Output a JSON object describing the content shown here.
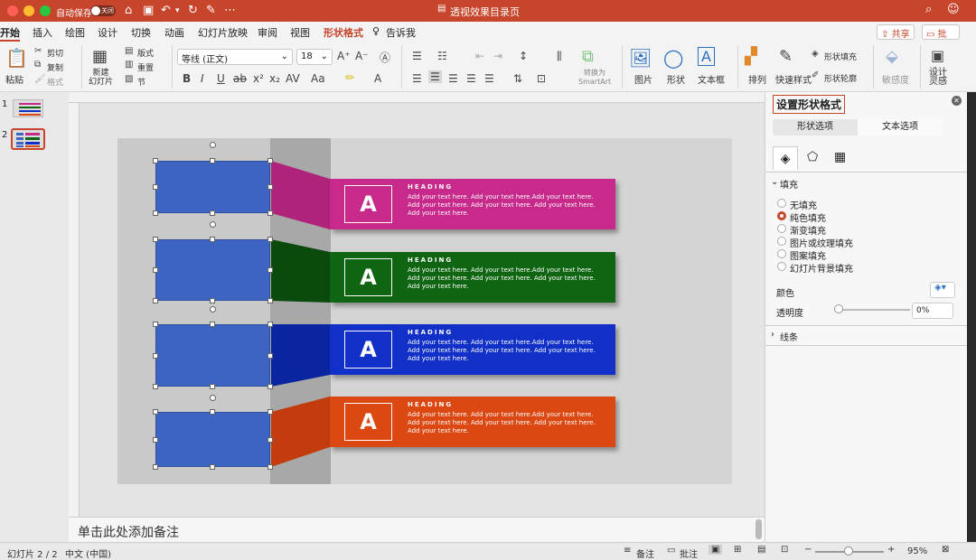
{
  "titlebar": {
    "autosave": "自动保存",
    "toggle": "关闭",
    "doc_title": "透视效果目录页"
  },
  "tabs": [
    "开始",
    "插入",
    "绘图",
    "设计",
    "切换",
    "动画",
    "幻灯片放映",
    "审阅",
    "视图",
    "形状格式",
    "告诉我"
  ],
  "share": "共享",
  "comment": "批注",
  "ribbon": {
    "paste": "粘贴",
    "cut": "剪切",
    "copy": "复制",
    "format": "格式",
    "new_slide": "新建\n幻灯片",
    "layout": "版式",
    "reset": "重置",
    "section": "节",
    "font": "等线 (正文)",
    "size": "18",
    "convert": "转换为\nSmartArt",
    "picture": "图片",
    "shape": "形状",
    "textbox": "文本框",
    "arrange": "排列",
    "quick_style": "快速样式",
    "shape_fill": "形状填充",
    "shape_outline": "形状轮廓",
    "sensitivity": "敏感度",
    "designer": "设计\n灵感"
  },
  "slides": {
    "n1": "1",
    "n2": "2"
  },
  "slide": {
    "items": [
      {
        "letter": "A",
        "heading": "HEADING",
        "text": "Add your text here. Add your text here.Add your text here. Add your text here. Add your text here. Add your text here. Add your text here.",
        "color": "#c82a8c"
      },
      {
        "letter": "A",
        "heading": "HEADING",
        "text": "Add your text here. Add your text here.Add your text here. Add your text here. Add your text here. Add your text here. Add your text here.",
        "color": "#0f6512"
      },
      {
        "letter": "A",
        "heading": "HEADING",
        "text": "Add your text here. Add your text here.Add your text here. Add your text here. Add your text here. Add your text here. Add your text here.",
        "color": "#1030c8"
      },
      {
        "letter": "A",
        "heading": "HEADING",
        "text": "Add your text here. Add your text here.Add your text here. Add your text here. Add your text here. Add your text here. Add your text here.",
        "color": "#dc4812"
      }
    ]
  },
  "notes": "单击此处添加备注",
  "panel": {
    "title": "设置形状格式",
    "tab1": "形状选项",
    "tab2": "文本选项",
    "fill_section": "填充",
    "options": [
      "无填充",
      "纯色填充",
      "渐变填充",
      "图片或纹理填充",
      "图案填充",
      "幻灯片背景填充"
    ],
    "color_label": "颜色",
    "transparency_label": "透明度",
    "transparency": "0%",
    "line_section": "线条"
  },
  "status": {
    "slide": "幻灯片 2 / 2",
    "lang": "中文 (中国)",
    "notes": "备注",
    "comments": "批注",
    "zoom": "95%"
  }
}
